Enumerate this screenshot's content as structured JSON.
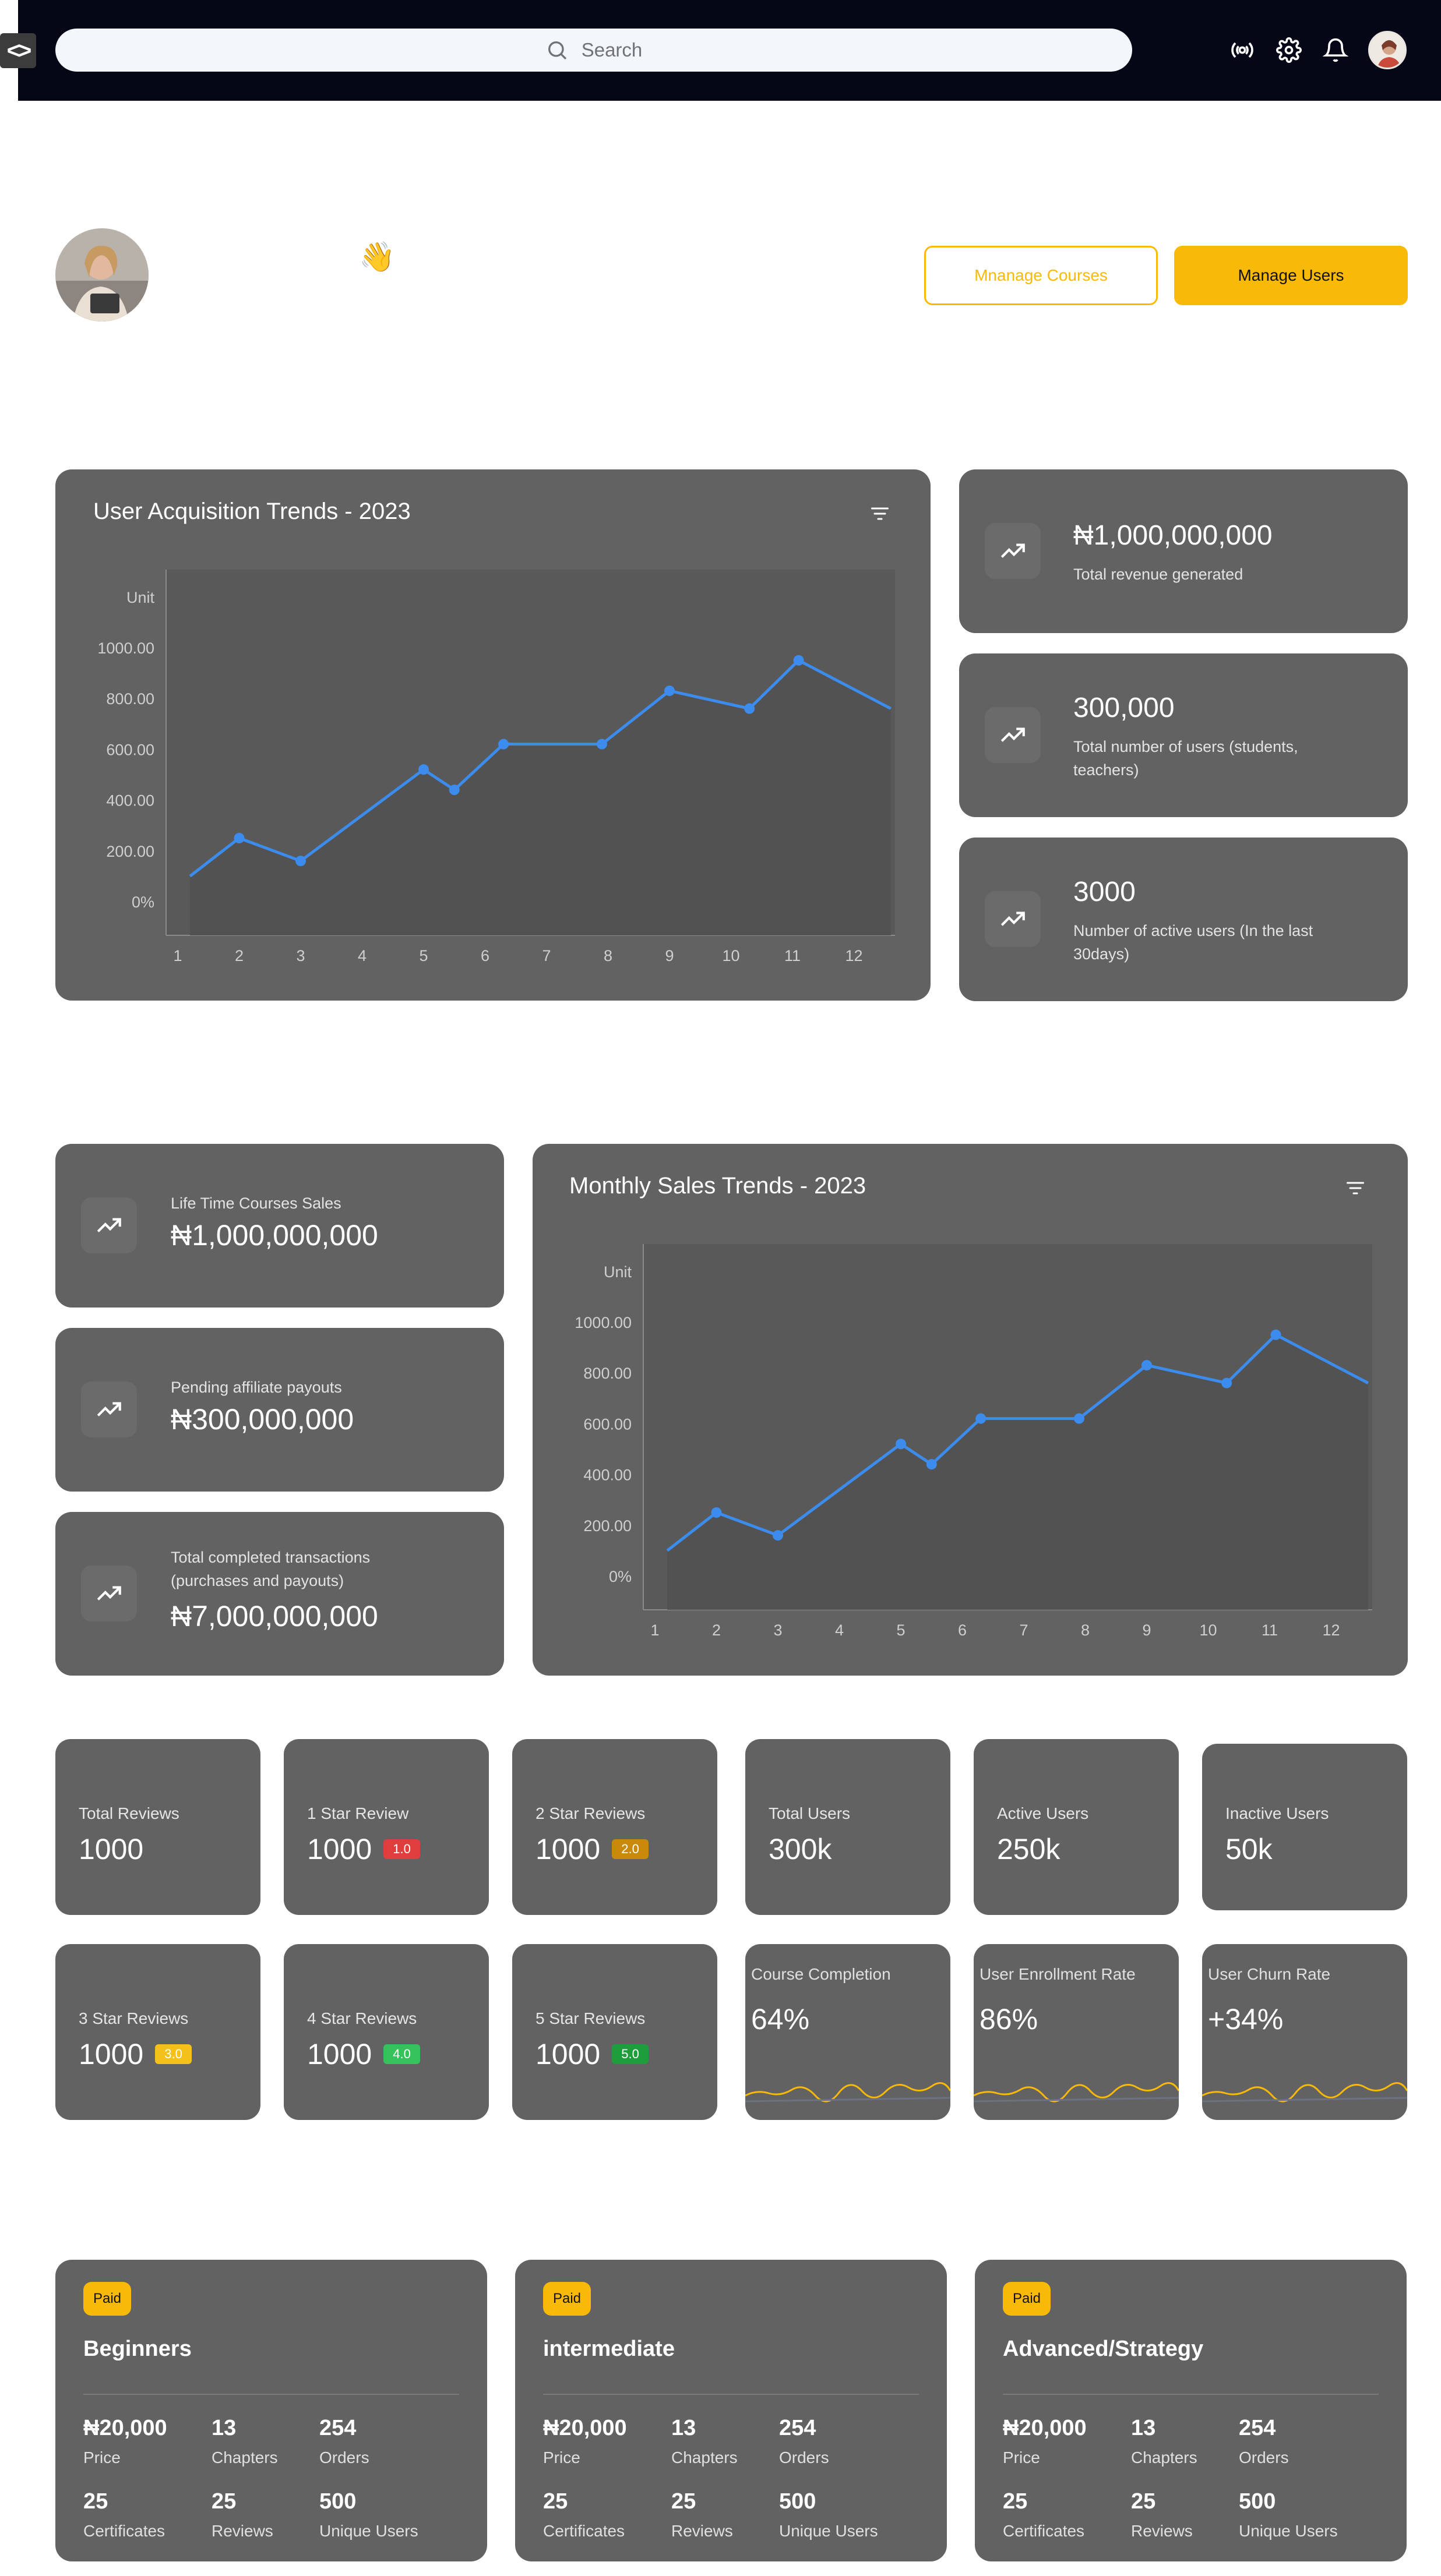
{
  "topbar": {
    "search_placeholder": "Search",
    "icons": [
      "code-toggle-icon",
      "search-icon",
      "broadcast-icon",
      "gear-icon",
      "bell-icon",
      "avatar"
    ]
  },
  "welcome": {
    "wave": "👋",
    "manage_courses_label": "Mnanage Courses",
    "manage_users_label": "Manage Users"
  },
  "colors": {
    "accent": "#f9b908",
    "card": "#626262",
    "line": "#3b8ced",
    "topbar": "#050717",
    "badge_1": "#e03d3d",
    "badge_2": "#c98a0b",
    "badge_3": "#f4c11a",
    "badge_4": "#36c25a",
    "badge_5": "#1e9e3a"
  },
  "user_acquisition": {
    "title": "User Acquisition Trends - 2023"
  },
  "monthly_sales": {
    "title": "Monthly Sales Trends - 2023"
  },
  "top_stats": [
    {
      "value": "₦1,000,000,000",
      "label": "Total revenue generated"
    },
    {
      "value": "300,000",
      "label": "Total number of users (students, teachers)"
    },
    {
      "value": "3000",
      "label": "Number of active users (In the last 30days)"
    }
  ],
  "sales_stats": [
    {
      "label": "Life Time Courses Sales",
      "value": "₦1,000,000,000"
    },
    {
      "label": "Pending affiliate payouts",
      "value": "₦300,000,000"
    },
    {
      "label": "Total completed transactions (purchases and payouts)",
      "value": "₦7,000,000,000"
    }
  ],
  "reviews": [
    {
      "label": "Total Reviews",
      "value": "1000",
      "badge": ""
    },
    {
      "label": "1 Star Review",
      "value": "1000",
      "badge": "1.0"
    },
    {
      "label": "2 Star Reviews",
      "value": "1000",
      "badge": "2.0"
    },
    {
      "label": "3 Star Reviews",
      "value": "1000",
      "badge": "3.0"
    },
    {
      "label": "4 Star Reviews",
      "value": "1000",
      "badge": "4.0"
    },
    {
      "label": "5 Star Reviews",
      "value": "1000",
      "badge": "5.0"
    }
  ],
  "users": [
    {
      "label": "Total Users",
      "value": "300k"
    },
    {
      "label": "Active Users",
      "value": "250k"
    },
    {
      "label": "Inactive Users",
      "value": "50k"
    }
  ],
  "metrics": [
    {
      "label": "Course Completion",
      "value": "64%"
    },
    {
      "label": "User Enrollment Rate",
      "value": "86%"
    },
    {
      "label": "User Churn Rate",
      "value": "+34%"
    }
  ],
  "courses": [
    {
      "badge": "Paid",
      "title": "Beginners",
      "price": "₦20,000",
      "price_label": "Price",
      "chapters": "13",
      "chapters_label": "Chapters",
      "orders": "254",
      "orders_label": "Orders",
      "certificates": "25",
      "certificates_label": "Certificates",
      "reviews": "25",
      "reviews_label": "Reviews",
      "unique": "500",
      "unique_label": "Unique Users"
    },
    {
      "badge": "Paid",
      "title": "intermediate",
      "price": "₦20,000",
      "price_label": "Price",
      "chapters": "13",
      "chapters_label": "Chapters",
      "orders": "254",
      "orders_label": "Orders",
      "certificates": "25",
      "certificates_label": "Certificates",
      "reviews": "25",
      "reviews_label": "Reviews",
      "unique": "500",
      "unique_label": "Unique Users"
    },
    {
      "badge": "Paid",
      "title": "Advanced/Strategy",
      "price": "₦20,000",
      "price_label": "Price",
      "chapters": "13",
      "chapters_label": "Chapters",
      "orders": "254",
      "orders_label": "Orders",
      "certificates": "25",
      "certificates_label": "Certificates",
      "reviews": "25",
      "reviews_label": "Reviews",
      "unique": "500",
      "unique_label": "Unique Users"
    }
  ],
  "chart_data": [
    {
      "type": "area",
      "title": "User Acquisition Trends - 2023",
      "ylabel": "Unit",
      "y_ticks": [
        "1000.00",
        "800.00",
        "600.00",
        "400.00",
        "200.00",
        "0%"
      ],
      "y_tick_values": [
        1000,
        800,
        600,
        400,
        200,
        0
      ],
      "x_ticks": [
        "1",
        "2",
        "3",
        "4",
        "5",
        "6",
        "7",
        "8",
        "9",
        "10",
        "11",
        "12"
      ],
      "ylim": [
        0,
        1000
      ],
      "xlim": [
        1,
        12.6
      ],
      "x": [
        1.2,
        2,
        3,
        5,
        5.5,
        6.3,
        7.9,
        9,
        10.3,
        11.1,
        12.6
      ],
      "values": [
        100,
        250,
        160,
        520,
        440,
        620,
        620,
        830,
        760,
        950,
        760
      ],
      "markers_at_index": [
        1,
        2,
        3,
        4,
        5,
        6,
        7,
        8,
        9
      ],
      "grid": false
    },
    {
      "type": "area",
      "title": "Monthly Sales Trends - 2023",
      "ylabel": "Unit",
      "y_ticks": [
        "1000.00",
        "800.00",
        "600.00",
        "400.00",
        "200.00",
        "0%"
      ],
      "y_tick_values": [
        1000,
        800,
        600,
        400,
        200,
        0
      ],
      "x_ticks": [
        "1",
        "2",
        "3",
        "4",
        "5",
        "6",
        "7",
        "8",
        "9",
        "10",
        "11",
        "12"
      ],
      "ylim": [
        0,
        1000
      ],
      "xlim": [
        1,
        12.6
      ],
      "x": [
        1.2,
        2,
        3,
        5,
        5.5,
        6.3,
        7.9,
        9,
        10.3,
        11.1,
        12.6
      ],
      "values": [
        100,
        250,
        160,
        520,
        440,
        620,
        620,
        830,
        760,
        950,
        760
      ],
      "markers_at_index": [
        1,
        2,
        3,
        4,
        5,
        6,
        7,
        8,
        9
      ],
      "grid": false
    }
  ]
}
